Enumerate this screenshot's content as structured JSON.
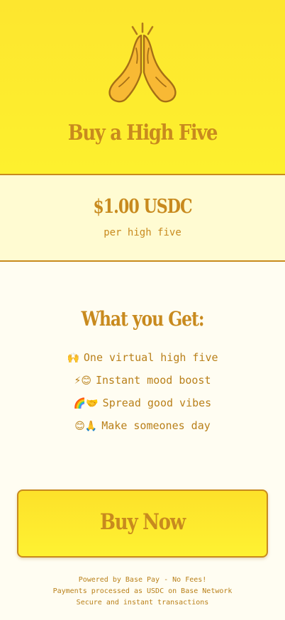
{
  "header": {
    "icon": "praying-hands-icon",
    "title": "Buy a High Five"
  },
  "price": {
    "amount": "$1.00 USDC",
    "unit": "per high five"
  },
  "benefits": {
    "title": "What you Get:",
    "items": [
      {
        "emoji": "🙌",
        "text": "One virtual high five"
      },
      {
        "emoji": "⚡😊",
        "text": "Instant mood boost"
      },
      {
        "emoji": "🌈🤝",
        "text": "Spread good vibes"
      },
      {
        "emoji": "😊🙏",
        "text": "Make someones day"
      }
    ]
  },
  "cta": {
    "label": "Buy Now"
  },
  "footer": {
    "line1": "Powered by Base Pay - No Fees!",
    "line2": "Payments processed as USDC on Base Network",
    "line3": "Secure and instant transactions"
  },
  "colors": {
    "accent": "#c88a1e",
    "hero_background": "#fde62f",
    "price_background": "#fffbd2",
    "page_background": "#fffdf2"
  }
}
